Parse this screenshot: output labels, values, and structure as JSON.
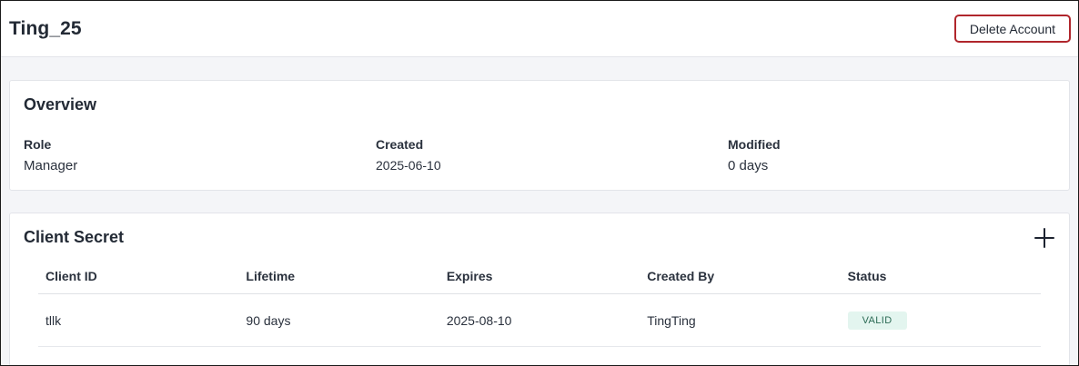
{
  "header": {
    "title": "Ting_25",
    "delete_label": "Delete Account"
  },
  "overview": {
    "title": "Overview",
    "fields": [
      {
        "label": "Role",
        "value": "Manager"
      },
      {
        "label": "Created",
        "value": "2025-06-10"
      },
      {
        "label": "Modified",
        "value": "0 days"
      }
    ]
  },
  "client_secret": {
    "title": "Client Secret",
    "add_icon": "plus-icon",
    "columns": [
      "Client ID",
      "Lifetime",
      "Expires",
      "Created By",
      "Status"
    ],
    "rows": [
      {
        "client_id": "tllk",
        "lifetime": "90 days",
        "expires": "2025-08-10",
        "created_by": "TingTing",
        "status": "VALID"
      }
    ]
  },
  "colors": {
    "danger_border": "#b0262c",
    "valid_badge_bg": "#e3f5ef",
    "valid_badge_text": "#2b6a54",
    "page_bg": "#f4f5f8"
  }
}
